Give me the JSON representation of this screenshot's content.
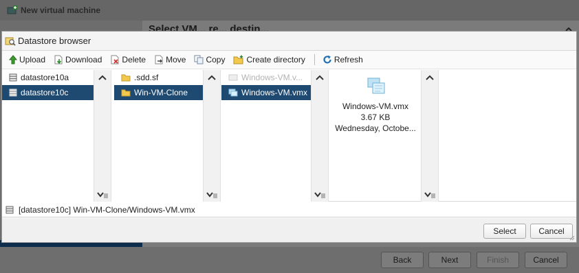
{
  "wizard": {
    "title": "New virtual machine",
    "heading": "Select VM... re... destin...",
    "buttons": {
      "back": "Back",
      "next": "Next",
      "finish": "Finish",
      "cancel": "Cancel"
    }
  },
  "dialog": {
    "title": "Datastore browser",
    "toolbar": {
      "upload": "Upload",
      "download": "Download",
      "delete": "Delete",
      "move": "Move",
      "copy": "Copy",
      "create_directory": "Create directory",
      "refresh": "Refresh"
    },
    "datastores": [
      "datastore10a",
      "datastore10c"
    ],
    "folders": [
      ".sdd.sf",
      "Win-VM-Clone"
    ],
    "files": [
      "Windows-VM.v...",
      "Windows-VM.vmx"
    ],
    "preview": {
      "name": "Windows-VM.vmx",
      "size": "3.67 KB",
      "date": "Wednesday, Octobe..."
    },
    "path": "[datastore10c] Win-VM-Clone/Windows-VM.vmx",
    "buttons": {
      "select": "Select",
      "cancel": "Cancel"
    }
  },
  "colors": {
    "selection": "#1e4a72",
    "accent": "#1e4a72"
  }
}
